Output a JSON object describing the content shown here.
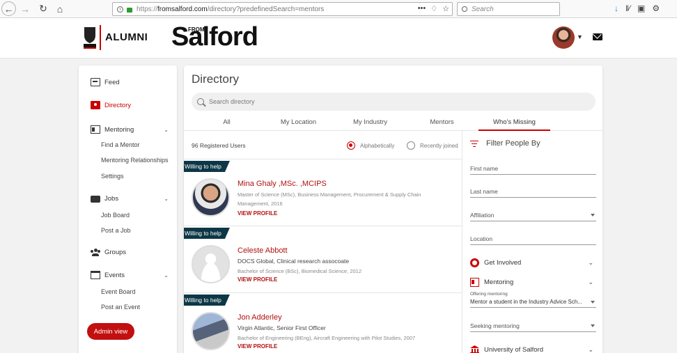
{
  "browser": {
    "url_proto": "https://",
    "url_host": "fromsalford.com",
    "url_path": "/directory?predefinedSearch=mentors",
    "search_placeholder": "Search",
    "icons": [
      "back-icon",
      "forward-icon",
      "reload-icon",
      "home-icon",
      "info-icon",
      "lock-icon",
      "more-icon",
      "pocket-icon",
      "bookmark-star-icon",
      "download-icon",
      "library-icon",
      "sidebar-icon",
      "extension-icon"
    ]
  },
  "header": {
    "alumni_label": "ALUMNI",
    "brand_from": "FROM",
    "brand_name": "Salford"
  },
  "sidebar": {
    "items": [
      {
        "label": "Feed"
      },
      {
        "label": "Directory"
      },
      {
        "label": "Mentoring"
      },
      {
        "label": "Jobs"
      },
      {
        "label": "Groups"
      },
      {
        "label": "Events"
      }
    ],
    "mentoring_sub": [
      "Find a Mentor",
      "Mentoring Relationships",
      "Settings"
    ],
    "jobs_sub": [
      "Job Board",
      "Post a Job"
    ],
    "events_sub": [
      "Event Board",
      "Post an Event"
    ],
    "admin_label": "Admin view"
  },
  "directory": {
    "title": "Directory",
    "search_placeholder": "Search directory",
    "tabs": [
      "All",
      "My Location",
      "My Industry",
      "Mentors",
      "Who's Missing"
    ],
    "active_tab": "Who's Missing",
    "registered": "96 Registered Users",
    "sort_options": [
      "Alphabetically",
      "Recently joined"
    ],
    "sort_selected": "Alphabetically",
    "help_tag": "Willing to help",
    "view_profile": "VIEW PROFILE",
    "people": [
      {
        "name": "Mina Ghaly ,MSc. ,MCIPS",
        "line1": "",
        "line2": "Master of Science (MSc), Business Management, Procurement & Supply Chain Management, 2016"
      },
      {
        "name": "Celeste Abbott",
        "line1": "DOCS Global, Clinical research assocoate",
        "line2": "Bachelor of Science (BSc), Biomedical Science, 2012"
      },
      {
        "name": "Jon Adderley",
        "line1": "Virgin Atlantic, Senior First Officer",
        "line2": "Bachelor of Engineering (BEng), Aircraft Engineering with Pilot Studies, 2007"
      }
    ]
  },
  "filters": {
    "title": "Filter People By",
    "first_name": "First name",
    "last_name": "Last name",
    "affiliation": "Affiliation",
    "location": "Location",
    "get_involved": "Get Involved",
    "mentoring": "Mentoring",
    "offering_label": "Offering mentoring",
    "offering_value": "Mentor a student in the Industry Advice Sch...",
    "seeking": "Seeking mentoring",
    "university": "University of Salford"
  },
  "colors": {
    "accent": "#c00000",
    "tag_bg": "#0d3746",
    "admin_button": "#c20f0f"
  }
}
